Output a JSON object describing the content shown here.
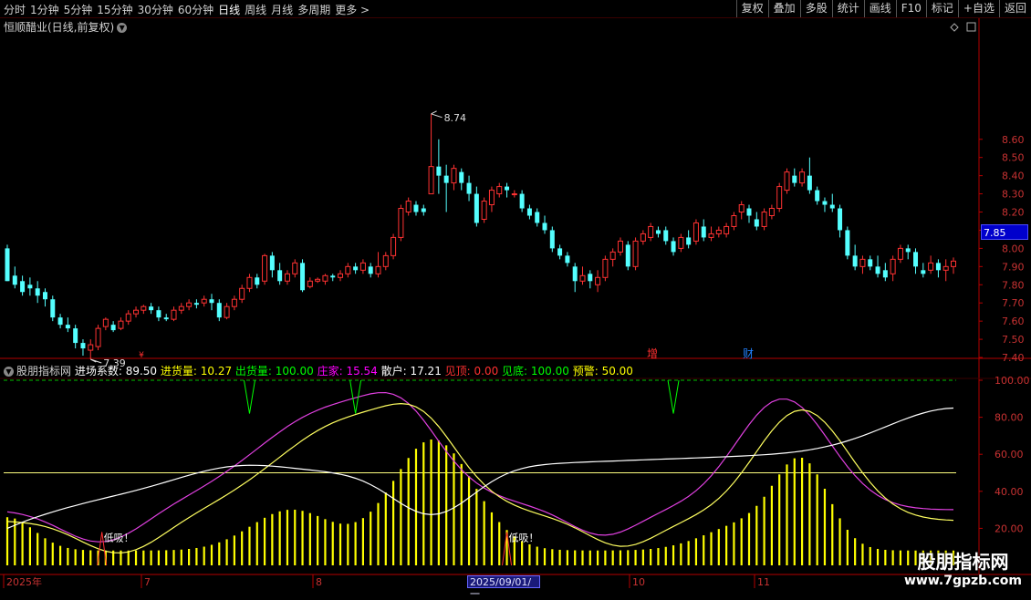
{
  "toolbar": {
    "periods": [
      "分时",
      "1分钟",
      "5分钟",
      "15分钟",
      "30分钟",
      "60分钟",
      "日线",
      "周线",
      "月线",
      "多周期",
      "更多 >"
    ],
    "active_period": "日线",
    "buttons": [
      "复权",
      "叠加",
      "多股",
      "统计",
      "画线",
      "F10",
      "标记",
      "+自选",
      "返回"
    ]
  },
  "main_chart": {
    "title": "恒顺醋业(日线,前复权)",
    "price_labels": [
      "8.60",
      "8.50",
      "8.40",
      "8.30",
      "8.20",
      "8.10",
      "8.00",
      "7.90",
      "7.80",
      "7.70",
      "7.60",
      "7.50",
      "7.40"
    ],
    "current_price": "7.85",
    "high_annotation": "8.74",
    "low_annotation": "7.39",
    "event_markers": [
      "增",
      "财"
    ],
    "colors": {
      "up": "#ff3232",
      "down": "#54ffff",
      "axis": "#b40000",
      "price_text": "#c83232"
    }
  },
  "indicator": {
    "name": "股朋指标网",
    "fields": [
      {
        "label": "进场系数: 89.50",
        "color": "#ffffff"
      },
      {
        "label": "进货量: 10.27",
        "color": "#ffff00"
      },
      {
        "label": "出货量: 100.00",
        "color": "#00ff00"
      },
      {
        "label": "庄家: 15.54",
        "color": "#ff00ff"
      },
      {
        "label": "散户: 17.21",
        "color": "#ffffff"
      },
      {
        "label": "见顶: 0.00",
        "color": "#ff3030"
      },
      {
        "label": "见底: 100.00",
        "color": "#00ff00"
      },
      {
        "label": "预警: 50.00",
        "color": "#ffff00"
      }
    ],
    "scale_labels": [
      "100.00",
      "80.00",
      "60.00",
      "40.00",
      "20.00"
    ],
    "signals": [
      "低吸！",
      "低吸！"
    ]
  },
  "time_axis": {
    "labels": [
      "2025年",
      "7",
      "8",
      "10",
      "11"
    ],
    "cursor_date": "2025/09/01/一"
  },
  "watermark": {
    "text": "股朋指标网",
    "url": "www.7gpzb.com"
  }
}
